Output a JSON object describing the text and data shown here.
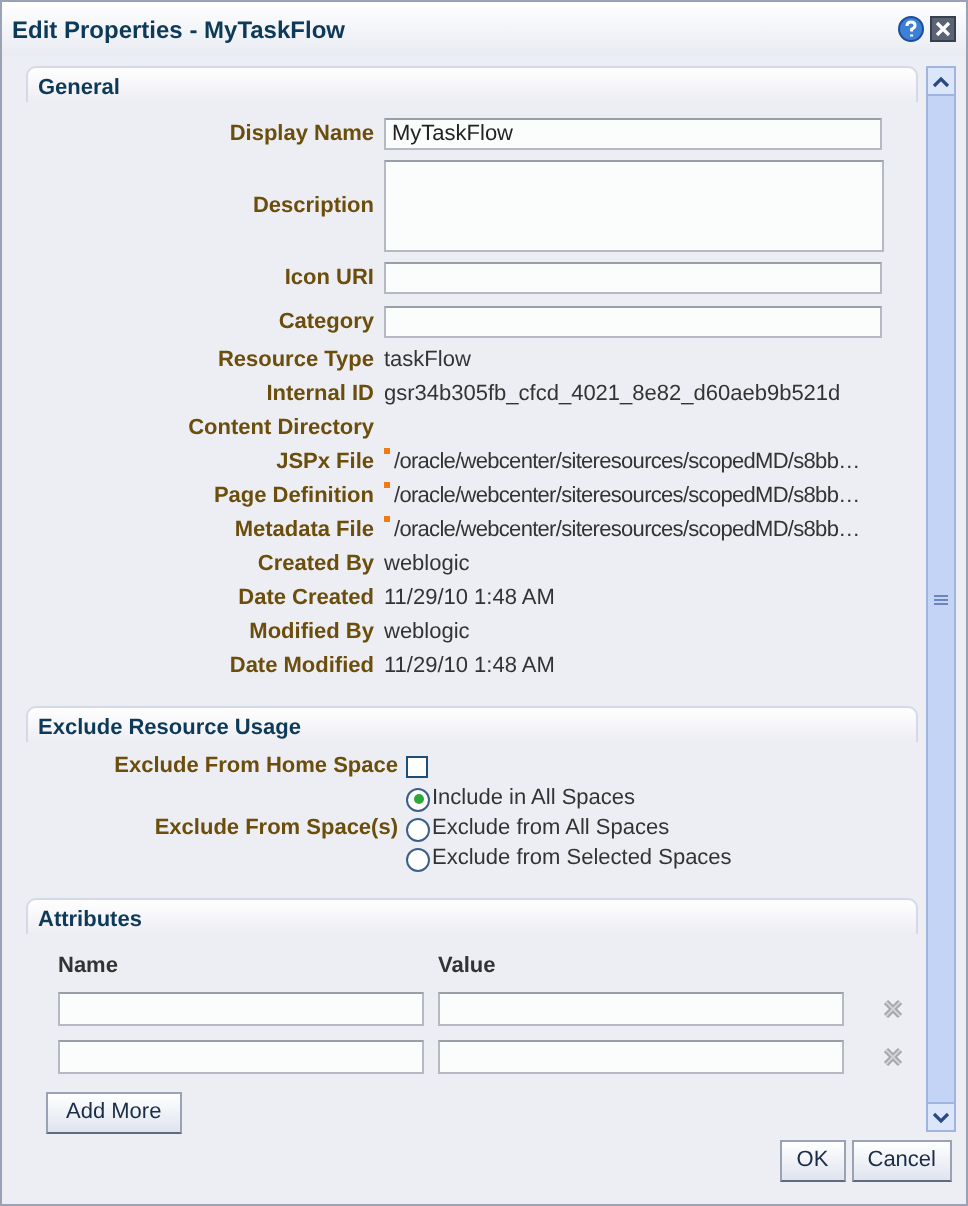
{
  "window": {
    "title": "Edit Properties - MyTaskFlow"
  },
  "general": {
    "title": "General",
    "rows": [
      {
        "kind": "field",
        "label": "Display Name",
        "value": "MyTaskFlow"
      },
      {
        "kind": "textarea",
        "label": "Description"
      },
      {
        "kind": "field",
        "label": "Icon URI"
      },
      {
        "kind": "field",
        "label": "Category"
      },
      {
        "kind": "text",
        "label": "Resource Type",
        "value": "taskFlow"
      },
      {
        "kind": "text",
        "label": "Internal ID",
        "value": "gsr34b305fb_cfcd_4021_8e82_d60aeb9b521d"
      },
      {
        "kind": "text",
        "label": "Content Directory"
      },
      {
        "kind": "file",
        "label": "JSPx File",
        "value": "/oracle/webcenter/siteresources/scopedMD/s8bb…"
      },
      {
        "kind": "file",
        "label": "Page Definition",
        "value": "/oracle/webcenter/siteresources/scopedMD/s8bb…"
      },
      {
        "kind": "file",
        "label": "Metadata File",
        "value": "/oracle/webcenter/siteresources/scopedMD/s8bb…"
      },
      {
        "kind": "text",
        "label": "Created By",
        "value": "weblogic"
      },
      {
        "kind": "text",
        "label": "Date Created",
        "value": "11/29/10 1:48 AM"
      },
      {
        "kind": "text",
        "label": "Modified By",
        "value": "weblogic"
      },
      {
        "kind": "text",
        "label": "Date Modified",
        "value": "11/29/10 1:48 AM"
      }
    ]
  },
  "exclude": {
    "title": "Exclude Resource Usage",
    "home_space": {
      "label": "Exclude From Home Space",
      "checked": false
    },
    "spaces": {
      "label": "Exclude From Space(s)",
      "options": [
        {
          "label": "Include in All Spaces",
          "selected": true
        },
        {
          "label": "Exclude from All Spaces",
          "selected": false
        },
        {
          "label": "Exclude from Selected Spaces",
          "selected": false
        }
      ]
    }
  },
  "attributes": {
    "title": "Attributes",
    "columns": [
      "Name",
      "Value"
    ],
    "rows": [
      {
        "removable": true
      },
      {
        "removable": true
      }
    ],
    "add_button": "Add More"
  },
  "buttons": [
    "OK",
    "Cancel"
  ]
}
